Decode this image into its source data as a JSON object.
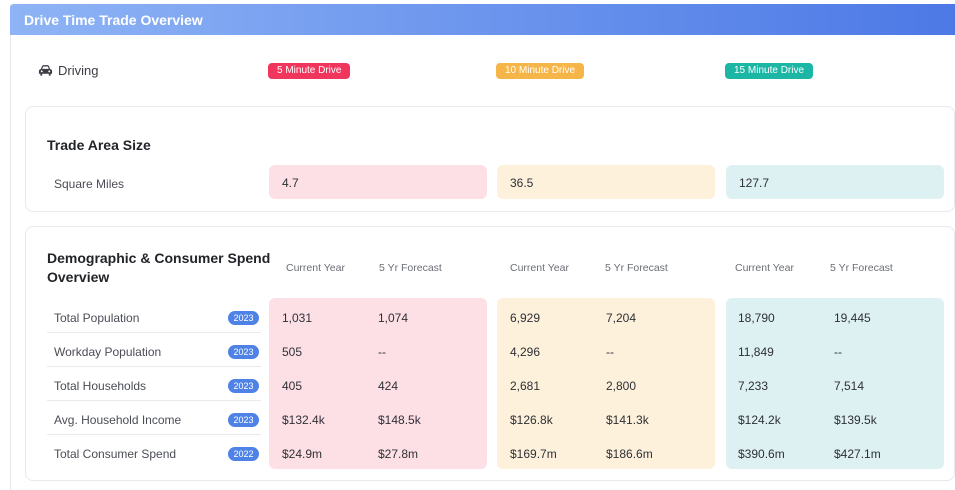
{
  "header": {
    "title": "Drive Time Trade Overview"
  },
  "mode": {
    "label": "Driving",
    "icon": "car-icon"
  },
  "drive_times": [
    {
      "label": "5 Minute Drive",
      "color": "#f1365e"
    },
    {
      "label": "10 Minute Drive",
      "color": "#f6b548"
    },
    {
      "label": "15 Minute Drive",
      "color": "#1cb7a4"
    }
  ],
  "trade_area": {
    "title": "Trade Area Size",
    "row_label": "Square Miles",
    "values": [
      "4.7",
      "36.5",
      "127.7"
    ]
  },
  "demographics": {
    "title_line1": "Demographic & Consumer Spend",
    "title_line2": "Overview",
    "col_current": "Current Year",
    "col_forecast": "5 Yr Forecast",
    "rows": [
      {
        "label": "Total Population",
        "year": "2023",
        "values": [
          "1,031",
          "1,074",
          "6,929",
          "7,204",
          "18,790",
          "19,445"
        ]
      },
      {
        "label": "Workday Population",
        "year": "2023",
        "values": [
          "505",
          "--",
          "4,296",
          "--",
          "11,849",
          "--"
        ]
      },
      {
        "label": "Total Households",
        "year": "2023",
        "values": [
          "405",
          "424",
          "2,681",
          "2,800",
          "7,233",
          "7,514"
        ]
      },
      {
        "label": "Avg. Household Income",
        "year": "2023",
        "values": [
          "$132.4k",
          "$148.5k",
          "$126.8k",
          "$141.3k",
          "$124.2k",
          "$139.5k"
        ]
      },
      {
        "label": "Total Consumer Spend",
        "year": "2022",
        "values": [
          "$24.9m",
          "$27.8m",
          "$169.7m",
          "$186.6m",
          "$390.6m",
          "$427.1m"
        ]
      }
    ]
  },
  "colors": {
    "header_gradient_end": "#4d79e6",
    "year_badge": "#4f82e6",
    "pink": "#fde0e6",
    "amber": "#fdf1dc",
    "teal": "#def1f2"
  }
}
